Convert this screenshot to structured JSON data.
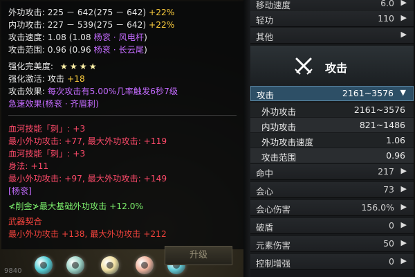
{
  "tooltip": {
    "lines": [
      {
        "text": "外功攻击: 225 － 642(275 － 642)",
        "extra": " +22%"
      },
      {
        "text": "内功攻击: 227 － 539(275 － 642)",
        "extra": " +22%"
      },
      {
        "text": "攻击速度: 1.08 (1.08 ",
        "source": "杨衮 · 风电杆",
        "tail": ")"
      },
      {
        "text": "攻击范围: 0.96 (0.96 ",
        "source": "杨衮 · 长云尾",
        "tail": ")"
      },
      {
        "text": "强化完美度: ",
        "stars": "★★★★"
      },
      {
        "text": "强化激活: 攻击 ",
        "extra": "+18"
      },
      {
        "text": "攻击效果: ",
        "effect": "每次攻击有5.00%几率触发6秒7级"
      },
      {
        "text": "急速效果(杨衮 · 齐眉刺)"
      },
      {
        "text": "血河技能「刺」: +3"
      },
      {
        "text": "最小外功攻击: +77,  最大外功攻击: +119"
      },
      {
        "text": "血河技能「刺」: +3"
      },
      {
        "text": "身法: +11"
      },
      {
        "text": "最小外功攻击: +97,  最大外功攻击: +149"
      },
      {
        "text": "[杨衮]"
      },
      {
        "text": "≮削金≯最大基础外功攻击  +12.0%"
      },
      {
        "text": "武器契合"
      },
      {
        "text": "最小外功攻击 +138,  最大外功攻击 +212"
      }
    ],
    "upgrade_label": "升级",
    "footer_num": "9840",
    "gem_colors": [
      "#58d0d8",
      "#9ed4c8",
      "#f3e2a4",
      "#f1b49e",
      "#63ccd9"
    ]
  },
  "panel": {
    "top_rows": [
      {
        "label": "移动速度",
        "value": "6.0"
      },
      {
        "label": "轻功",
        "value": "110"
      },
      {
        "label": "其他",
        "value": ""
      }
    ],
    "section_title": "攻击",
    "section_icon": "crossed-swords-icon",
    "header": {
      "label": "攻击",
      "value": "2161~3576",
      "arrow": "▼"
    },
    "sub_rows": [
      {
        "label": "外功攻击",
        "value": "2161~3576"
      },
      {
        "label": "内功攻击",
        "value": "821~1486"
      },
      {
        "label": "外功攻击速度",
        "value": "1.06"
      },
      {
        "label": "攻击范围",
        "value": "0.96"
      }
    ],
    "rows": [
      {
        "label": "命中",
        "value": "217"
      },
      {
        "label": "会心",
        "value": "73"
      },
      {
        "label": "会心伤害",
        "value": "156.0%"
      },
      {
        "label": "破盾",
        "value": "0"
      },
      {
        "label": "元素伤害",
        "value": "50"
      },
      {
        "label": "控制增强",
        "value": "0"
      }
    ],
    "arrow": "▶"
  }
}
